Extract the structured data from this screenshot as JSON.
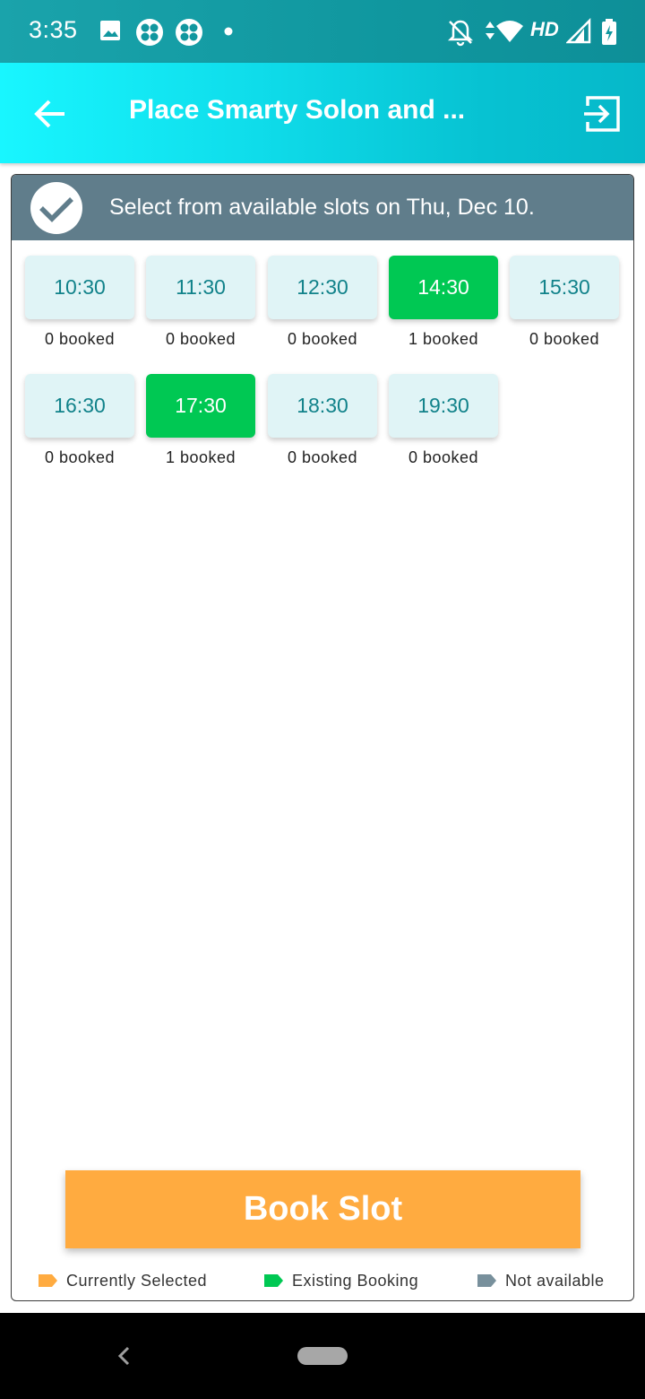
{
  "status_bar": {
    "time": "3:35",
    "network_label": "HD",
    "icons": [
      "image-icon",
      "app-grid-icon",
      "app-grid-icon",
      "dot-icon",
      "notifications-off-icon",
      "data-arrows-icon",
      "wifi-icon",
      "signal-icon",
      "battery-charging-icon"
    ]
  },
  "app_bar": {
    "title": "Place Smarty Solon and ...",
    "back_icon": "arrow-left-icon",
    "exit_icon": "exit-to-app-icon",
    "background": "#0fdcea"
  },
  "header": {
    "text": "Select from available slots on Thu, Dec 10.",
    "icon": "check-circle-icon",
    "background": "#607d8b"
  },
  "slots": [
    {
      "time": "10:30",
      "booked_label": "0 booked",
      "status": "available"
    },
    {
      "time": "11:30",
      "booked_label": "0 booked",
      "status": "available"
    },
    {
      "time": "12:30",
      "booked_label": "0 booked",
      "status": "available"
    },
    {
      "time": "14:30",
      "booked_label": "1 booked",
      "status": "existing"
    },
    {
      "time": "15:30",
      "booked_label": "0 booked",
      "status": "available"
    },
    {
      "time": "16:30",
      "booked_label": "0 booked",
      "status": "available"
    },
    {
      "time": "17:30",
      "booked_label": "1 booked",
      "status": "existing"
    },
    {
      "time": "18:30",
      "booked_label": "0 booked",
      "status": "available"
    },
    {
      "time": "19:30",
      "booked_label": "0 booked",
      "status": "available"
    }
  ],
  "book_button": {
    "label": "Book Slot",
    "color": "#ffab40"
  },
  "legend": [
    {
      "label": "Currently Selected",
      "color": "#ffab40"
    },
    {
      "label": "Existing Booking",
      "color": "#00c853"
    },
    {
      "label": "Not available",
      "color": "#78909c"
    }
  ],
  "colors": {
    "available_bg": "#e0f4f6",
    "available_text": "#11828a",
    "existing": "#00c853"
  }
}
